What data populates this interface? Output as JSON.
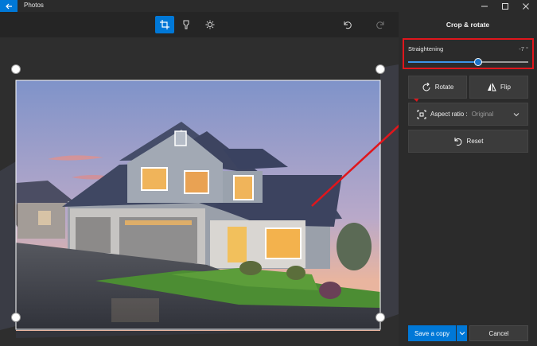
{
  "titlebar": {
    "app_title": "Photos",
    "back_icon": "back-arrow-icon",
    "minimize_icon": "minimize-icon",
    "maximize_icon": "maximize-icon",
    "close_icon": "close-icon"
  },
  "toolbar": {
    "tools": [
      {
        "icon": "crop-icon",
        "active": true
      },
      {
        "icon": "filter-icon",
        "active": false
      },
      {
        "icon": "brightness-icon",
        "active": false
      }
    ],
    "undo_icon": "undo-icon",
    "redo_icon": "redo-icon"
  },
  "colors": {
    "accent": "#0078d7",
    "annotation_red": "#e0161c",
    "panel_bg": "#2b2b2b",
    "editor_bg": "#2a2a2a"
  },
  "panel": {
    "title": "Crop & rotate",
    "straightening": {
      "label": "Straightening",
      "value_text": "-7 °",
      "level_fraction": 0.58
    },
    "rotate_label": "Rotate",
    "flip_label": "Flip",
    "aspect_label": "Aspect ratio :",
    "aspect_value": "Original",
    "reset_label": "Reset",
    "save_label": "Save a copy",
    "cancel_label": "Cancel"
  }
}
